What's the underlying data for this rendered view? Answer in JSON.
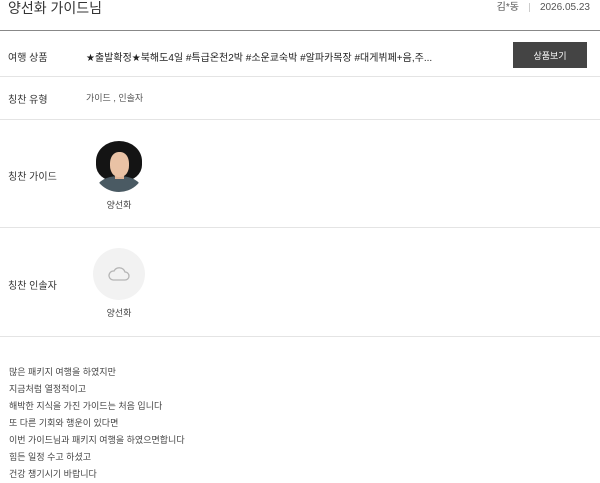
{
  "header": {
    "title": "양선화 가이드님",
    "author": "김*동",
    "date": "2026.05.23"
  },
  "product": {
    "label": "여행 상품",
    "value": "★출발확정★북해도4일 #특급온천2박 #소운쿄숙박 #알파카목장 #대게뷔페+음,주...",
    "button_label": "상품보기"
  },
  "praise_type": {
    "label": "칭찬 유형",
    "value": "가이드 , 인솔자"
  },
  "praise_guide": {
    "label": "칭찬 가이드",
    "name": "양선화"
  },
  "praise_escort": {
    "label": "칭찬 인솔자",
    "name": "양선화",
    "icon": "cloud-icon"
  },
  "review": {
    "lines": [
      "많은 패키지 여행을 하였지만",
      "지금처럼 열정적이고",
      "해박한 지식을 가진 가이드는 처음 입니다",
      "또 다른 기회와 행운이 있다면",
      "이번 가이드님과 패키지 여행을 하였으면합니다",
      "힘든 일정 수고 하셨고",
      "건강 챙기시기 바랍니다"
    ]
  }
}
